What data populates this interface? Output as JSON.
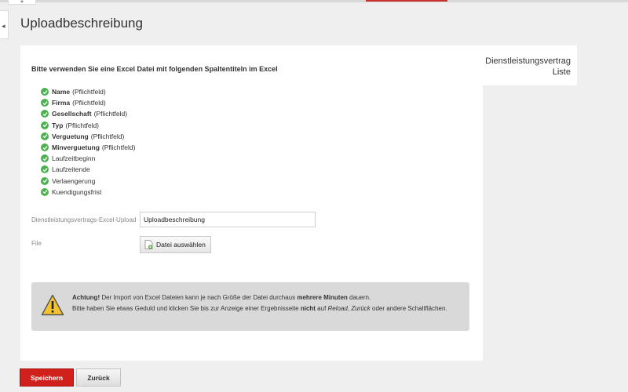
{
  "window": {
    "plus_tab": "+",
    "side_tab_glyph": "◂"
  },
  "page": {
    "title": "Uploadbeschreibung"
  },
  "side_panel": {
    "line1": "Dienstleistungsvertrag",
    "line2": "Liste"
  },
  "intro": "Bitte verwenden Sie eine Excel Datei mit folgenden Spaltentiteln im Excel",
  "fields": [
    {
      "name": "Name",
      "note": "(Pflichtfeld)"
    },
    {
      "name": "Firma",
      "note": "(Pflichtfeld)"
    },
    {
      "name": "Gesellschaft",
      "note": "(Pflichtfeld)"
    },
    {
      "name": "Typ",
      "note": "(Pflichtfeld)"
    },
    {
      "name": "Verguetung",
      "note": "(Pflichtfeld)"
    },
    {
      "name": "Minverguetung",
      "note": "(Pflichtfeld)"
    },
    {
      "name": "Laufzeitbeginn",
      "note": ""
    },
    {
      "name": "Laufzeitende",
      "note": ""
    },
    {
      "name": "Verlaengerung",
      "note": ""
    },
    {
      "name": "Kuendigungsfrist",
      "note": ""
    }
  ],
  "form": {
    "upload_label": "Dienstleistungsvertrags-Excel-Upload",
    "upload_value": "Uploadbeschreibung",
    "file_label": "File",
    "file_button": "Datei auswählen"
  },
  "alert": {
    "strong1": "Achtung!",
    "text1": " Der Import von Excel Dateien kann je nach Größe der Datei durchaus ",
    "strong2": "mehrere Minuten",
    "text2": " dauern.",
    "text3": "Bitte haben Sie etwas Geduld und klicken Sie bis zur Anzeige einer Ergebnisseite ",
    "strong3": "nicht",
    "text4": " auf ",
    "em1": "Reload",
    "text5": ", ",
    "em2": "Zurück",
    "text6": " oder andere Schaltflächen."
  },
  "buttons": {
    "save": "Speichern",
    "back": "Zurück"
  },
  "colors": {
    "primary": "#d0211c",
    "check": "#4caf50",
    "warning": "#f2c230"
  }
}
